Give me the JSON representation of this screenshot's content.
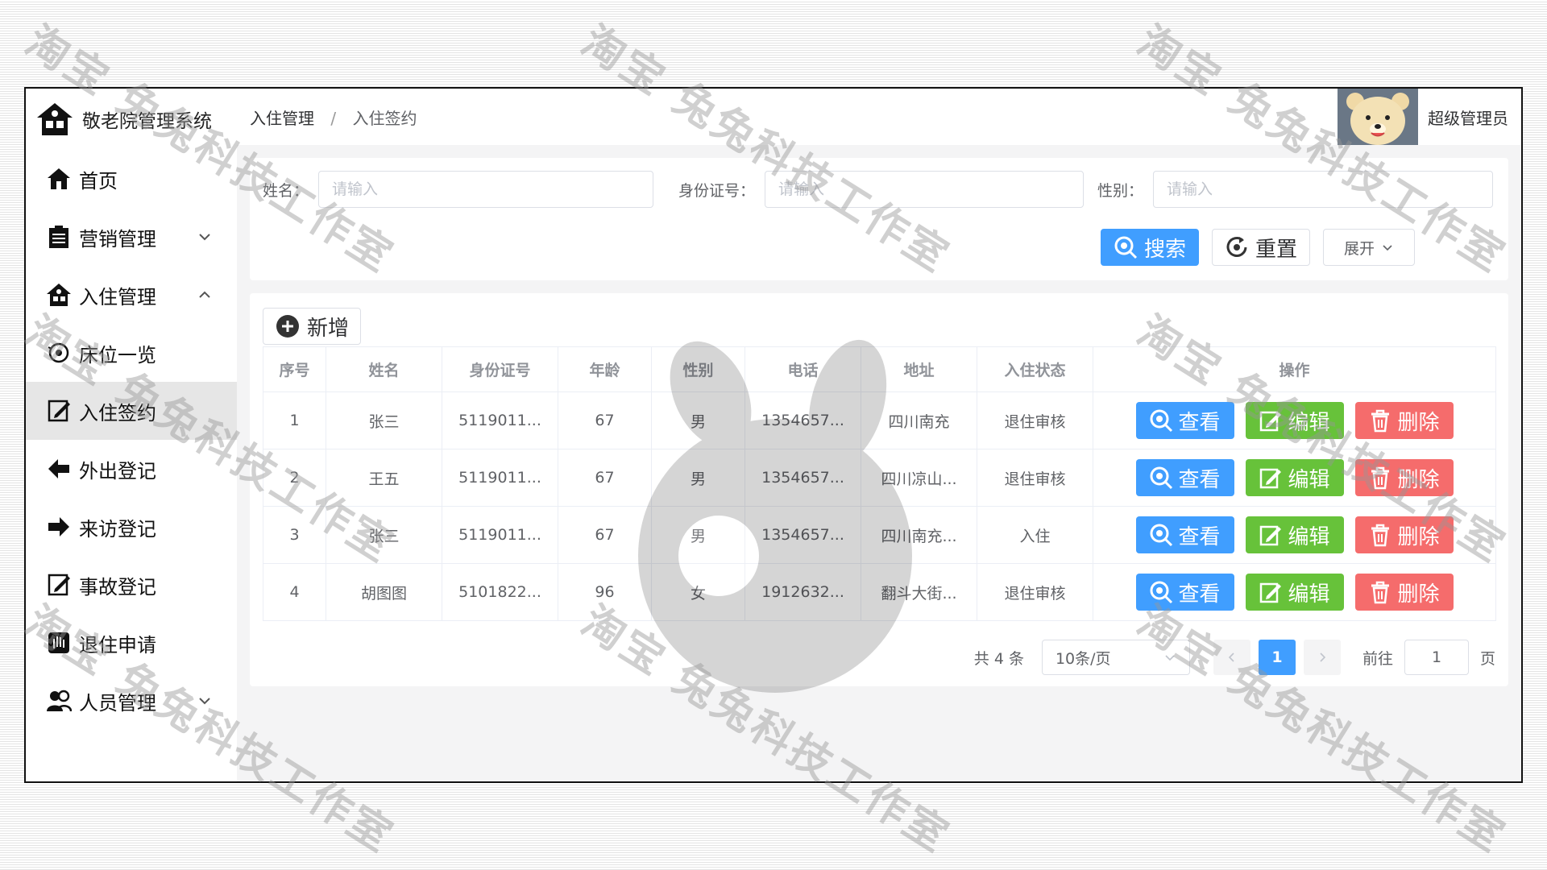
{
  "app": {
    "title": "敬老院管理系统"
  },
  "sidebar": {
    "items": [
      {
        "label": "首页",
        "icon": "home-icon"
      },
      {
        "label": "营销管理",
        "icon": "clipboard-icon",
        "expand": "collapsed"
      },
      {
        "label": "入住管理",
        "icon": "house-icon",
        "expand": "expanded"
      },
      {
        "label": "床位一览",
        "icon": "eye-icon"
      },
      {
        "label": "入住签约",
        "icon": "sign-icon",
        "active": true
      },
      {
        "label": "外出登记",
        "icon": "out-arrow-icon"
      },
      {
        "label": "来访登记",
        "icon": "in-arrow-icon"
      },
      {
        "label": "事故登记",
        "icon": "edit-icon"
      },
      {
        "label": "退住申请",
        "icon": "hand-icon"
      },
      {
        "label": "人员管理",
        "icon": "people-icon",
        "expand": "collapsed"
      }
    ]
  },
  "header": {
    "breadcrumb": [
      "入住管理",
      "入住签约"
    ],
    "separator": "/",
    "user": "超级管理员"
  },
  "search": {
    "name_label": "姓名：",
    "name_placeholder": "请输入",
    "id_label": "身份证号：",
    "id_placeholder": "请输入",
    "gender_label": "性别：",
    "gender_placeholder": "请输入",
    "search_btn": "搜索",
    "reset_btn": "重置",
    "expand_btn": "展开"
  },
  "table": {
    "add_btn": "新增",
    "columns": [
      "序号",
      "姓名",
      "身份证号",
      "年龄",
      "性别",
      "电话",
      "地址",
      "入住状态",
      "操作"
    ],
    "rows": [
      [
        "1",
        "张三",
        "5119011...",
        "67",
        "男",
        "1354657...",
        "四川南充",
        "退住审核"
      ],
      [
        "2",
        "王五",
        "5119011...",
        "67",
        "男",
        "1354657...",
        "四川凉山...",
        "退住审核"
      ],
      [
        "3",
        "张三",
        "5119011...",
        "67",
        "男",
        "1354657...",
        "四川南充...",
        "入住"
      ],
      [
        "4",
        "胡图图",
        "5101822...",
        "96",
        "女",
        "1912632...",
        "翻斗大街...",
        "退住审核"
      ]
    ],
    "op_view": "查看",
    "op_edit": "编辑",
    "op_delete": "删除"
  },
  "pager": {
    "total": "共 4 条",
    "page_size": "10条/页",
    "current": "1",
    "goto_label": "前往",
    "goto_value": "1",
    "goto_suffix": "页"
  },
  "watermark": "淘宝 兔兔科技工作室",
  "colors": {
    "primary": "#409eff",
    "success": "#67c23a",
    "danger": "#f56c6c"
  }
}
